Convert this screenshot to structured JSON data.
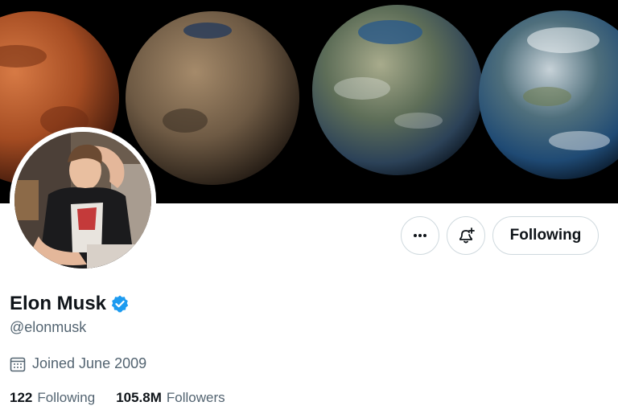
{
  "profile": {
    "name": "Elon Musk",
    "handle": "@elonmusk",
    "joined": "Joined June 2009",
    "verified": true
  },
  "actions": {
    "follow_button_label": "Following",
    "more_icon": "more-horizontal-icon",
    "notify_icon": "bell-plus-icon"
  },
  "stats": {
    "following_count": "122",
    "following_label": "Following",
    "followers_count": "105.8M",
    "followers_label": "Followers"
  },
  "colors": {
    "verified_blue": "#1d9bf0",
    "text_primary": "#0f1419",
    "text_secondary": "#536471",
    "border": "#cfd9de"
  }
}
